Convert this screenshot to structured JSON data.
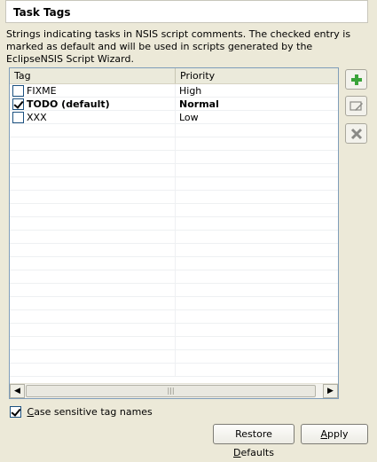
{
  "title": "Task Tags",
  "description": "Strings indicating tasks in NSIS script comments. The checked entry is marked as default and will be used in scripts generated by the EclipseNSIS Script Wizard.",
  "table": {
    "columns": [
      "Tag",
      "Priority"
    ],
    "rows": [
      {
        "tag": "FIXME",
        "priority": "High",
        "checked": false
      },
      {
        "tag": "TODO (default)",
        "priority": "Normal",
        "checked": true
      },
      {
        "tag": "XXX",
        "priority": "Low",
        "checked": false
      }
    ]
  },
  "icons": {
    "add": "add-icon",
    "edit": "edit-icon",
    "remove": "remove-icon"
  },
  "case_sensitive": {
    "label": "Case sensitive tag names",
    "checked": true
  },
  "buttons": {
    "restore_defaults": "Restore Defaults",
    "apply": "Apply"
  },
  "colors": {
    "add_icon": "#3aa33a",
    "disabled_icon": "#8a8a86"
  }
}
